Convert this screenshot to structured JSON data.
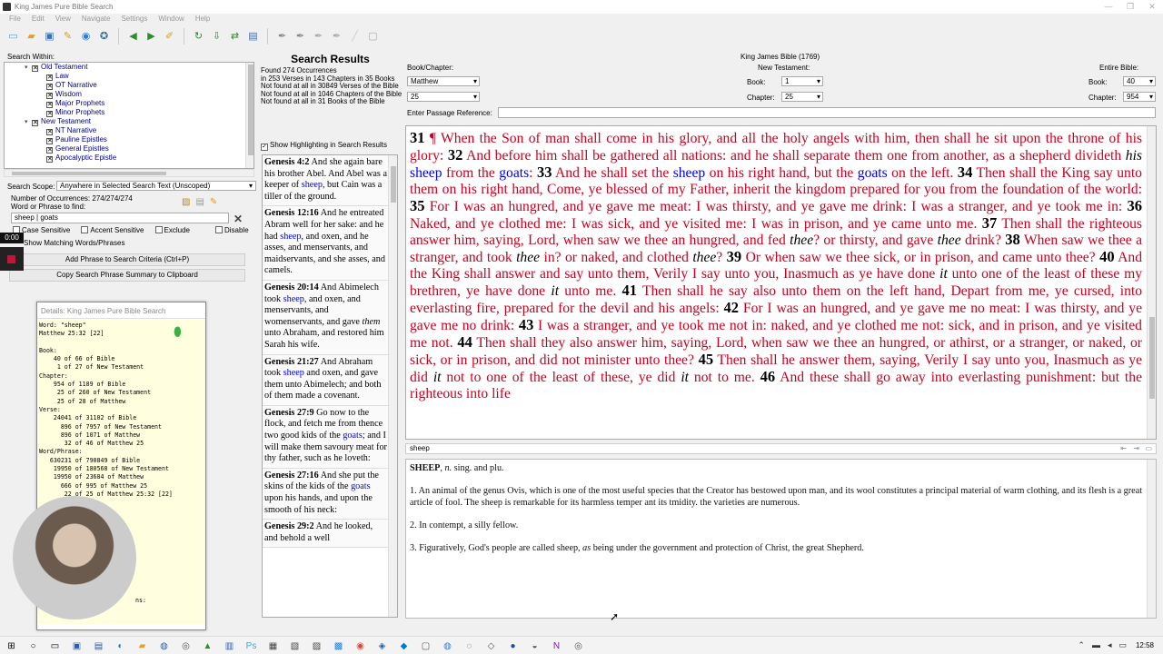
{
  "window": {
    "title": "King James Pure Bible Search"
  },
  "menu": [
    "File",
    "Edit",
    "View",
    "Navigate",
    "Settings",
    "Window",
    "Help"
  ],
  "search_within": {
    "label": "Search Within:",
    "tree": [
      {
        "label": "Old Testament",
        "level": 0
      },
      {
        "label": "Law",
        "level": 1
      },
      {
        "label": "OT Narrative",
        "level": 1
      },
      {
        "label": "Wisdom",
        "level": 1
      },
      {
        "label": "Major Prophets",
        "level": 1
      },
      {
        "label": "Minor Prophets",
        "level": 1
      },
      {
        "label": "New Testament",
        "level": 0
      },
      {
        "label": "NT Narrative",
        "level": 1
      },
      {
        "label": "Pauline Epistles",
        "level": 1
      },
      {
        "label": "General Epistles",
        "level": 1
      },
      {
        "label": "Apocalyptic Epistle",
        "level": 1
      }
    ]
  },
  "scope": {
    "label": "Search Scope:",
    "value": "Anywhere in Selected Search Text (Unscoped)"
  },
  "occurrences": "Number of Occurrences: 274/274/274",
  "find_label": "Word or Phrase to find:",
  "find_value": "sheep | goats",
  "options": {
    "case": "Case Sensitive",
    "accent": "Accent Sensitive",
    "exclude": "Exclude",
    "disable": "Disable"
  },
  "show_matching": "Show Matching Words/Phrases",
  "add_phrase": "Add Phrase to Search Criteria (Ctrl+P)",
  "copy_summary": "Copy Search Phrase Summary to Clipboard",
  "recording": {
    "timer": "0:00"
  },
  "details": {
    "title": "Details: King James Pure Bible Search",
    "body": "Word: \"sheep\"\nMatthew 25:32 [22]\n\nBook:\n    40 of 66 of Bible\n     1 of 27 of New Testament\nChapter:\n    954 of 1189 of Bible\n     25 of 260 of New Testament\n     25 of 28 of Matthew\nVerse:\n    24041 of 31102 of Bible\n      896 of 7957 of New Testament\n      896 of 1071 of Matthew\n       32 of 46 of Matthew 25\nWord/Phrase:\n   630231 of 790849 of Bible\n    19950 of 180568 of New Testament\n    19950 of 23684 of Matthew\n      666 of 995 of Matthew 25\n       22 of 25 of Matthew 25:32 [22]",
    "tail": "ns:"
  },
  "search_results": {
    "title": "Search Results",
    "stats": [
      "Found 274 Occurrences",
      "   in 253 Verses in 143 Chapters in 35 Books",
      "   Not found at all in 30849 Verses of the Bible",
      "   Not found at all in 1046 Chapters of the Bible",
      "   Not found at all in 31 Books of the Bible"
    ],
    "show_highlighting": "Show Highlighting in Search Results",
    "items": [
      {
        "ref": "Genesis 4:2",
        "parts": [
          " And she again bare his brother Abel. And Abel was a keeper of ",
          "sheep",
          ", but Cain was a tiller of the ground."
        ]
      },
      {
        "ref": "Genesis 12:16",
        "parts": [
          " And he entreated Abram well for her sake: and he had ",
          "sheep",
          ", and oxen, and he asses, and menservants, and maidservants, and she asses, and camels."
        ]
      },
      {
        "ref": "Genesis 20:14",
        "parts": [
          " And Abimelech took ",
          "sheep",
          ", and oxen, and menservants, and womenservants, and gave ",
          "them",
          " unto Abraham, and restored him Sarah his wife."
        ]
      },
      {
        "ref": "Genesis 21:27",
        "parts": [
          " And Abraham took ",
          "sheep",
          " and oxen, and gave them unto Abimelech; and both of them made a covenant."
        ]
      },
      {
        "ref": "Genesis 27:9",
        "parts": [
          " Go now to the flock, and fetch me from thence two good kids of the ",
          "goats",
          "; and I will make them savoury meat for thy father, such as he loveth:"
        ]
      },
      {
        "ref": "Genesis 27:16",
        "parts": [
          " And she put the skins of the kids of the ",
          "goats",
          " upon his hands, and upon the smooth of his neck:"
        ]
      },
      {
        "ref": "Genesis 29:2",
        "parts": [
          " And he looked, and behold a well",
          "",
          ""
        ]
      }
    ]
  },
  "nav": {
    "book_chapter_label": "Book/Chapter:",
    "book_value": "Matthew",
    "chapter_value": "25",
    "passage_label": "Enter Passage Reference:",
    "kjv_label": "King James Bible (1769)",
    "nt_label": "New Testament:",
    "entire_label": "Entire Bible:",
    "book_label": "Book:",
    "chapter_label": "Chapter:",
    "nt_book": "1",
    "nt_chapter": "25",
    "eb_book": "40",
    "eb_chapter": "954"
  },
  "scripture": [
    {
      "v": "31",
      "segs": [
        [
          "t",
          " ¶ When the Son of man shall come in his glory, and all the holy angels with him, then shall he sit upon the throne of his glory: "
        ]
      ]
    },
    {
      "v": "32",
      "segs": [
        [
          "t",
          " And before him shall be gathered all nations: and he shall separate them one from another, as a shepherd divideth "
        ],
        [
          "i",
          "his"
        ],
        [
          "t",
          " "
        ],
        [
          "w",
          "sheep"
        ],
        [
          "t",
          " from the "
        ],
        [
          "w",
          "goats"
        ],
        [
          "t",
          ": "
        ]
      ]
    },
    {
      "v": "33",
      "segs": [
        [
          "t",
          " And he shall set the "
        ],
        [
          "w",
          "sheep"
        ],
        [
          "t",
          " on his right hand, but the "
        ],
        [
          "w",
          "goats"
        ],
        [
          "t",
          " on the left. "
        ]
      ]
    },
    {
      "v": "34",
      "segs": [
        [
          "t",
          " Then shall the King say unto them on his right hand, Come, ye blessed of my Father, inherit the kingdom prepared for you from the foundation of the world: "
        ]
      ]
    },
    {
      "v": "35",
      "segs": [
        [
          "t",
          " For I was an hungred, and ye gave me meat: I was thirsty, and ye gave me drink: I was a stranger, and ye took me in: "
        ]
      ]
    },
    {
      "v": "36",
      "segs": [
        [
          "t",
          " Naked, and ye clothed me: I was sick, and ye visited me: I was in prison, and ye came unto me. "
        ]
      ]
    },
    {
      "v": "37",
      "segs": [
        [
          "t",
          " Then shall the righteous answer him, saying, Lord, when saw we thee an hungred, and fed "
        ],
        [
          "i",
          "thee"
        ],
        [
          "t",
          "? or thirsty, and gave "
        ],
        [
          "i",
          "thee"
        ],
        [
          "t",
          " drink? "
        ]
      ]
    },
    {
      "v": "38",
      "segs": [
        [
          "t",
          " When saw we thee a stranger, and took "
        ],
        [
          "i",
          "thee"
        ],
        [
          "t",
          " in? or naked, and clothed "
        ],
        [
          "i",
          "thee"
        ],
        [
          "t",
          "? "
        ]
      ]
    },
    {
      "v": "39",
      "segs": [
        [
          "t",
          " Or when saw we thee sick, or in prison, and came unto thee? "
        ]
      ]
    },
    {
      "v": "40",
      "segs": [
        [
          "t",
          " And the King shall answer and say unto them, Verily I say unto you, Inasmuch as ye have done "
        ],
        [
          "i",
          "it"
        ],
        [
          "t",
          " unto one of the least of these my brethren, ye have done "
        ],
        [
          "i",
          "it"
        ],
        [
          "t",
          " unto me. "
        ]
      ]
    },
    {
      "v": "41",
      "segs": [
        [
          "t",
          " Then shall he say also unto them on the left hand, Depart from me, ye cursed, into everlasting fire, prepared for the devil and his angels: "
        ]
      ]
    },
    {
      "v": "42",
      "segs": [
        [
          "t",
          " For I was an hungred, and ye gave me no meat: I was thirsty, and ye gave me no drink: "
        ]
      ]
    },
    {
      "v": "43",
      "segs": [
        [
          "t",
          " I was a stranger, and ye took me not in: naked, and ye clothed me not: sick, and in prison, and ye visited me not. "
        ]
      ]
    },
    {
      "v": "44",
      "segs": [
        [
          "t",
          " Then shall they also answer him, saying, Lord, when saw we thee an hungred, or athirst, or a stranger, or naked, or sick, or in prison, and did not minister unto thee? "
        ]
      ]
    },
    {
      "v": "45",
      "segs": [
        [
          "t",
          " Then shall he answer them, saying, Verily I say unto you, Inasmuch as ye did "
        ],
        [
          "i",
          "it"
        ],
        [
          "t",
          " not to one of the least of these, ye did "
        ],
        [
          "i",
          "it"
        ],
        [
          "t",
          " not to me. "
        ]
      ]
    },
    {
      "v": "46",
      "segs": [
        [
          "t",
          " And these shall go away into everlasting punishment: but the righteous into life"
        ]
      ]
    }
  ],
  "word_bar": "sheep",
  "dictionary": {
    "headword": "SHEEP",
    "pos": "n.",
    "grammar": " sing. and plu.",
    "def1": "1. An animal of the genus Ovis, which is one of the most useful species that the Creator has bestowed upon man, and its wool constitutes a principal material of warm clothing, and its flesh is a great article of fool. The sheep is remarkable for its harmless temper ant its tmidity. the varieties are numerous.",
    "def2": "2. In contempt, a silly fellow.",
    "def3_a": "3. Figuratively, God's people are called sheep, ",
    "def3_i": "as",
    "def3_b": " being under the government and protection of Christ, the great Shepherd."
  },
  "clock": "12:58",
  "colors": {
    "words_of_christ": "#c8001e",
    "highlight": "#0000ee",
    "details_bg": "#ffffe0"
  }
}
